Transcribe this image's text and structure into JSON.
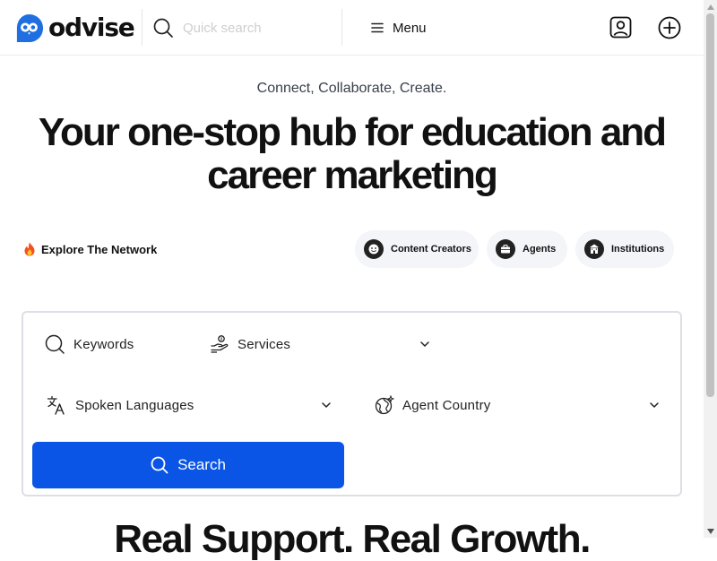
{
  "header": {
    "brand": "odvise",
    "search": {
      "placeholder": "Quick search",
      "value": ""
    },
    "menu_label": "Menu",
    "icons": {
      "search": "search-icon",
      "menu": "hamburger-icon",
      "user": "user-account-icon",
      "add": "plus-circle-icon"
    }
  },
  "hero": {
    "tagline": "Connect, Collaborate, Create.",
    "headline": "Your one-stop hub for education and career marketing"
  },
  "network": {
    "explore_label": "Explore The Network",
    "explore_icon": "fire-icon",
    "pills": [
      {
        "label": "Content Creators",
        "icon": "smiley-icon"
      },
      {
        "label": "Agents",
        "icon": "briefcase-icon"
      },
      {
        "label": "Institutions",
        "icon": "building-icon"
      }
    ]
  },
  "search_card": {
    "keywords_label": "Keywords",
    "services_label": "Services",
    "languages_label": "Spoken Languages",
    "country_label": "Agent Country",
    "search_button": "Search"
  },
  "section2": {
    "heading": "Real Support. Real Growth."
  },
  "colors": {
    "accent": "#0a55e6",
    "brand_logo": "#1f6fe0",
    "pill_bg": "#f3f5f8",
    "border": "#dcdfe4"
  }
}
